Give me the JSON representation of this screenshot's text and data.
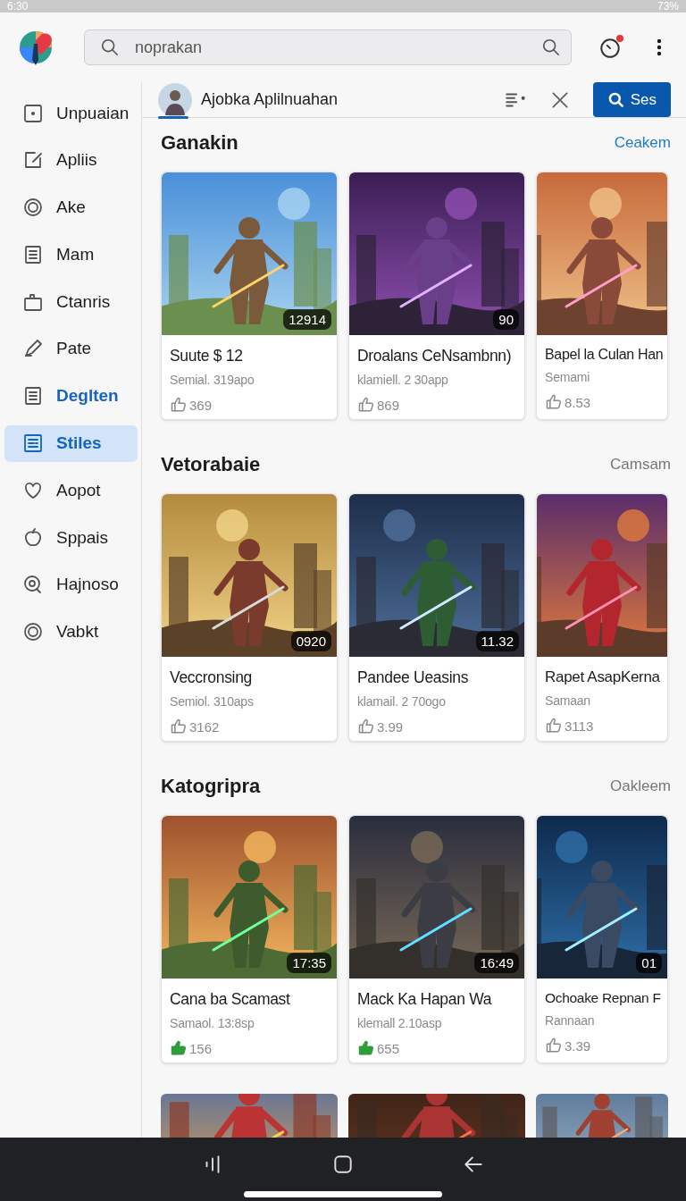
{
  "status_bar": {
    "time": "6:30",
    "battery": "73%"
  },
  "search": {
    "placeholder": "noprakan"
  },
  "sidebar": {
    "items": [
      {
        "label": "Unpuaian",
        "selected": false,
        "emphasized": false
      },
      {
        "label": "Apliis",
        "selected": false,
        "emphasized": false
      },
      {
        "label": "Ake",
        "selected": false,
        "emphasized": false
      },
      {
        "label": "Mam",
        "selected": false,
        "emphasized": false
      },
      {
        "label": "Ctanris",
        "selected": false,
        "emphasized": false
      },
      {
        "label": "Pate",
        "selected": false,
        "emphasized": false
      },
      {
        "label": "Deglten",
        "selected": false,
        "emphasized": true
      },
      {
        "label": "Stiles",
        "selected": true,
        "emphasized": false
      },
      {
        "label": "Aopot",
        "selected": false,
        "emphasized": false
      },
      {
        "label": "Sppais",
        "selected": false,
        "emphasized": false
      },
      {
        "label": "Hajnoso",
        "selected": false,
        "emphasized": false
      },
      {
        "label": "Vabkt",
        "selected": false,
        "emphasized": false
      }
    ]
  },
  "header": {
    "title": "Ajobka Aplilnuahan",
    "selected": true,
    "notification": true,
    "search_button": "Ses"
  },
  "sections": [
    {
      "title": "Ganakin",
      "link": "Ceakem",
      "accent": true,
      "cards": [
        {
          "title": "Suute $ 12",
          "subtitle": "Semial. 319apo",
          "rating": "369",
          "liked": false,
          "badge": "12914"
        },
        {
          "title": "Droalans CeNsambnn)",
          "subtitle": "klamiell. 2 30app",
          "rating": "869",
          "liked": false,
          "badge": "90"
        },
        {
          "title": "Bapel la Culan Han",
          "subtitle": "Semami",
          "rating": "8.53",
          "liked": false
        }
      ]
    },
    {
      "title": "Vetorabaie",
      "link": "Camsam",
      "accent": false,
      "cards": [
        {
          "title": "Veccronsing",
          "subtitle": "Semiol. 310aps",
          "rating": "3162",
          "liked": false,
          "badge": "0920"
        },
        {
          "title": "Pandee Ueasins",
          "subtitle": "klamail. 2 70ogo",
          "rating": "3.99",
          "liked": false,
          "badge": "11.32"
        },
        {
          "title": "Rapet AsapKerna",
          "subtitle": "Samaan",
          "rating": "3113",
          "liked": false
        }
      ]
    },
    {
      "title": "Katogripra",
      "link": "Oakleem",
      "accent": false,
      "cards": [
        {
          "title": "Cana ba Scamast",
          "subtitle": "Samaol. 13:8sp",
          "rating": "156",
          "liked": true,
          "badge": "17:35"
        },
        {
          "title": "Mack Ka Hapan Wa",
          "subtitle": "klemall 2.10asp",
          "rating": "655",
          "liked": true,
          "badge": "16:49"
        },
        {
          "title": "Ochoake Repnan F",
          "subtitle": "Rannaan",
          "rating": "3.39",
          "liked": false,
          "badge": "01"
        }
      ]
    }
  ]
}
